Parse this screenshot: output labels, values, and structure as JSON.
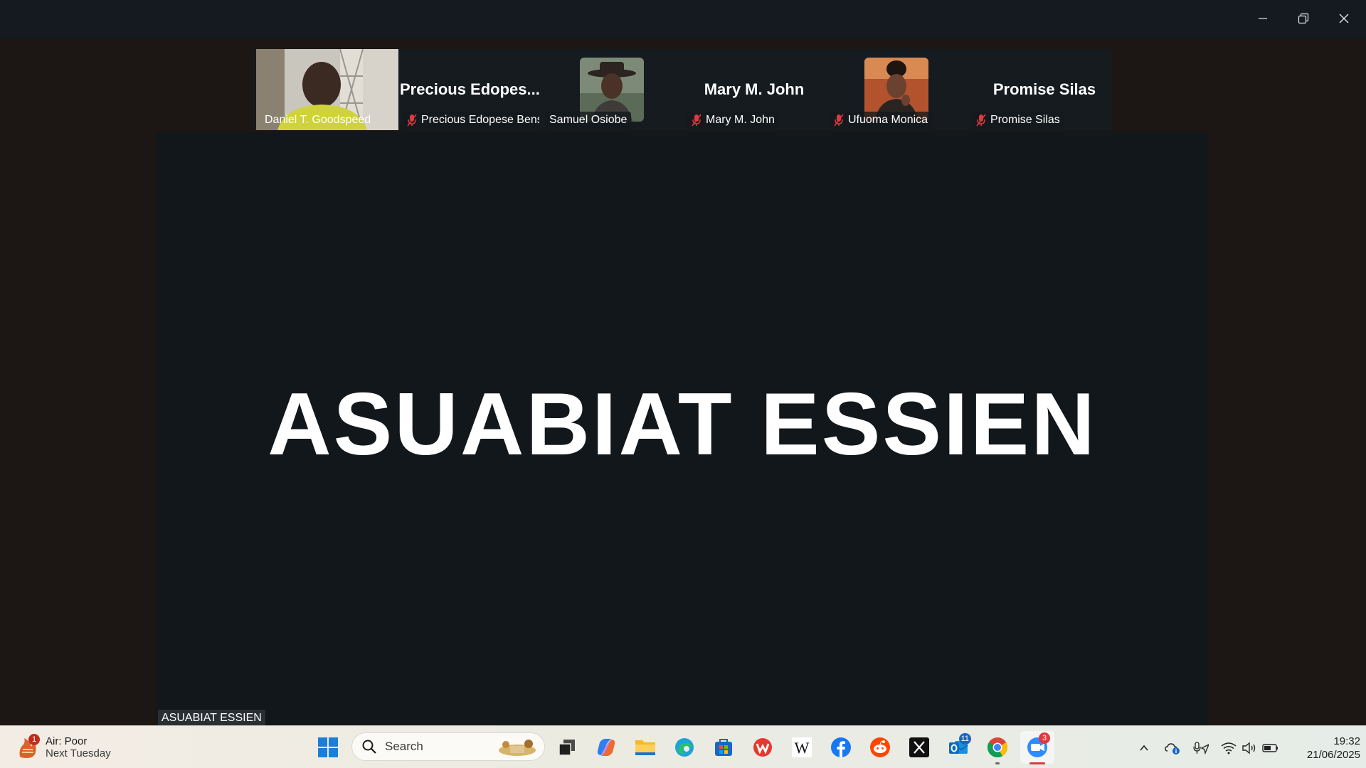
{
  "window": {
    "minimize_label": "Minimize",
    "restore_label": "Restore",
    "close_label": "Close"
  },
  "participants": [
    {
      "tile_name": "",
      "tag": "Daniel T. Goodspeed",
      "muted": false,
      "video": true
    },
    {
      "tile_name": "Precious  Edopes...",
      "tag": "Precious Edopese Bens...",
      "muted": true,
      "video": false
    },
    {
      "tile_name": "",
      "tag": "Samuel Osiobe",
      "muted": false,
      "video": false,
      "avatar": true
    },
    {
      "tile_name": "Mary M. John",
      "tag": "Mary M. John",
      "muted": true,
      "video": false
    },
    {
      "tile_name": "",
      "tag": "Ufuoma Monica",
      "muted": true,
      "video": false,
      "avatar": true
    },
    {
      "tile_name": "Promise Silas",
      "tag": "Promise Silas",
      "muted": true,
      "video": false
    }
  ],
  "stage": {
    "speaker_display": "ASUABIAT ESSIEN",
    "speaker_tag": "ASUABIAT ESSIEN"
  },
  "taskbar": {
    "weather": {
      "line1": "Air: Poor",
      "line2": "Next Tuesday",
      "badge": "1"
    },
    "search_placeholder": "Search",
    "pins": [
      {
        "name": "start-icon"
      },
      {
        "name": "task-view-icon"
      },
      {
        "name": "copilot-icon"
      },
      {
        "name": "file-explorer-icon"
      },
      {
        "name": "edge-icon"
      },
      {
        "name": "store-icon"
      },
      {
        "name": "wps-office-icon"
      },
      {
        "name": "wikipedia-icon"
      },
      {
        "name": "facebook-icon"
      },
      {
        "name": "reddit-icon"
      },
      {
        "name": "x-icon"
      },
      {
        "name": "outlook-icon",
        "badge": "11"
      },
      {
        "name": "chrome-icon"
      },
      {
        "name": "zoom-icon",
        "badge": "3"
      }
    ],
    "clock": {
      "time": "19:32",
      "date": "21/06/2025"
    }
  },
  "colors": {
    "accent_red": "#e0393e",
    "zoom_blue": "#2d8cff",
    "stage_bg": "#12171b"
  }
}
